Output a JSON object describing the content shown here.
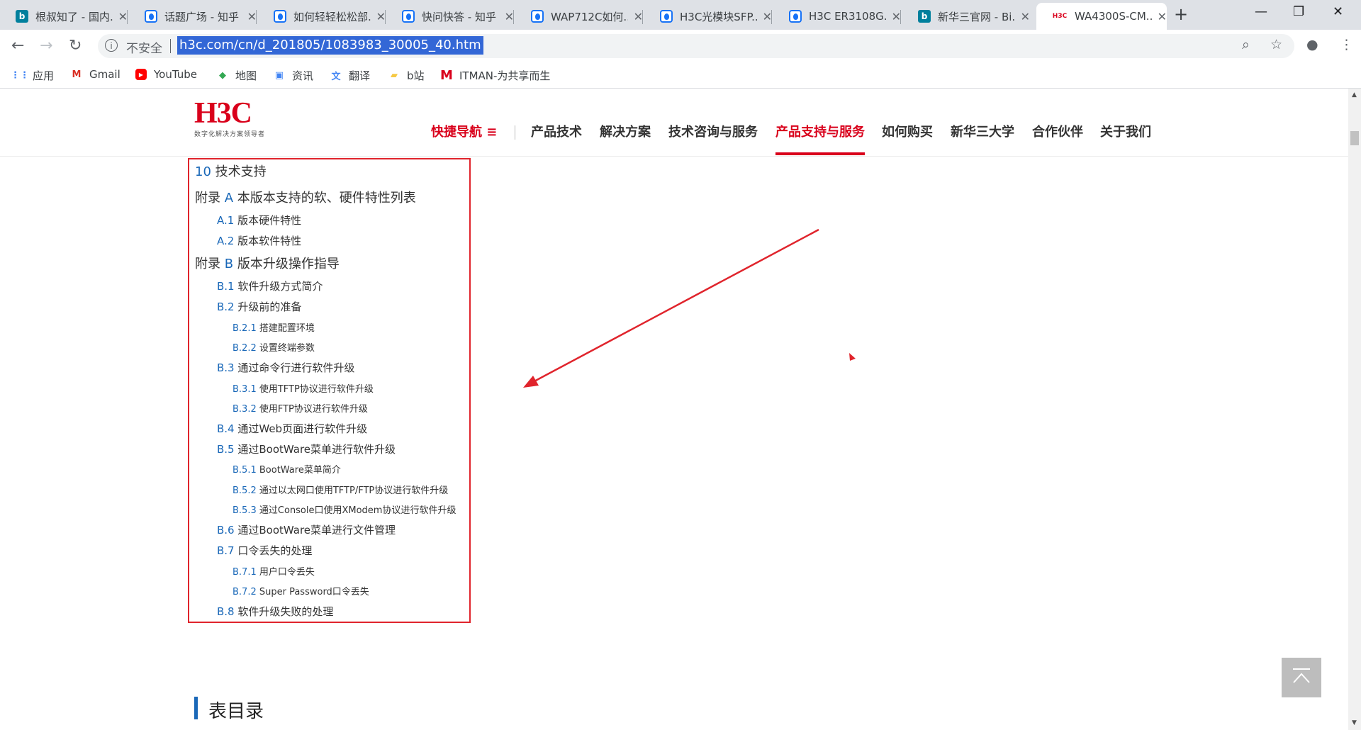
{
  "browser": {
    "tabs": [
      {
        "icon": "bing",
        "title": "根叔知了 - 国内..."
      },
      {
        "icon": "zhihu",
        "title": "话题广场 - 知乎"
      },
      {
        "icon": "zhihu",
        "title": "如何轻轻松松部..."
      },
      {
        "icon": "zhihu",
        "title": "快问快答 - 知乎"
      },
      {
        "icon": "zhihu",
        "title": "WAP712C如何..."
      },
      {
        "icon": "zhihu",
        "title": "H3C光模块SFP..."
      },
      {
        "icon": "zhihu",
        "title": "H3C ER3108G..."
      },
      {
        "icon": "bing",
        "title": "新华三官网 - Bi..."
      },
      {
        "icon": "h3c",
        "title": "WA4300S-CM..."
      }
    ],
    "active_tab_index": 8,
    "omnibox": {
      "security_label": "不安全",
      "url": "h3c.com/cn/d_201805/1083983_30005_40.htm"
    },
    "bookmarks": [
      {
        "icon": "apps",
        "label": "应用"
      },
      {
        "icon": "gmail",
        "label": "Gmail"
      },
      {
        "icon": "youtube",
        "label": "YouTube"
      },
      {
        "icon": "maps",
        "label": "地图"
      },
      {
        "icon": "news",
        "label": "资讯"
      },
      {
        "icon": "translate",
        "label": "翻译"
      },
      {
        "icon": "folder",
        "label": "b站"
      },
      {
        "icon": "itman",
        "label": "ITMAN-为共享而生"
      }
    ]
  },
  "site": {
    "logo": {
      "mark": "H3C",
      "slogan": "数字化解决方案领导者"
    },
    "nav": {
      "quick": "快捷导航 ≡",
      "items": [
        "产品技术",
        "解决方案",
        "技术咨询与服务",
        "产品支持与服务",
        "如何购买",
        "新华三大学",
        "合作伙伴",
        "关于我们"
      ],
      "active": "产品支持与服务"
    }
  },
  "toc": [
    {
      "num": "10",
      "text": " 技术支持",
      "level": 1
    },
    {
      "num": "附录 A",
      "text": " 本版本支持的软、硬件特性列表",
      "level": 1
    },
    {
      "num": "A.1",
      "text": " 版本硬件特性",
      "level": 2
    },
    {
      "num": "A.2",
      "text": " 版本软件特性",
      "level": 2
    },
    {
      "num": "附录 B",
      "text": " 版本升级操作指导",
      "level": 1
    },
    {
      "num": "B.1",
      "text": " 软件升级方式简介",
      "level": 2
    },
    {
      "num": "B.2",
      "text": " 升级前的准备",
      "level": 2
    },
    {
      "num": "B.2.1",
      "text": " 搭建配置环境",
      "level": 3
    },
    {
      "num": "B.2.2",
      "text": " 设置终端参数",
      "level": 3
    },
    {
      "num": "B.3",
      "text": " 通过命令行进行软件升级",
      "level": 2
    },
    {
      "num": "B.3.1",
      "text": " 使用TFTP协议进行软件升级",
      "level": 3
    },
    {
      "num": "B.3.2",
      "text": " 使用FTP协议进行软件升级",
      "level": 3
    },
    {
      "num": "B.4",
      "text": " 通过Web页面进行软件升级",
      "level": 2
    },
    {
      "num": "B.5",
      "text": " 通过BootWare菜单进行软件升级",
      "level": 2
    },
    {
      "num": "B.5.1",
      "text": " BootWare菜单简介",
      "level": 3
    },
    {
      "num": "B.5.2",
      "text": " 通过以太网口使用TFTP/FTP协议进行软件升级",
      "level": 3
    },
    {
      "num": "B.5.3",
      "text": " 通过Console口使用XModem协议进行软件升级",
      "level": 3
    },
    {
      "num": "B.6",
      "text": " 通过BootWare菜单进行文件管理",
      "level": 2
    },
    {
      "num": "B.7",
      "text": " 口令丢失的处理",
      "level": 2
    },
    {
      "num": "B.7.1",
      "text": " 用户口令丢失",
      "level": 3
    },
    {
      "num": "B.7.2",
      "text": " Super Password口令丢失",
      "level": 3
    },
    {
      "num": "B.8",
      "text": " 软件升级失败的处理",
      "level": 2
    }
  ],
  "section": {
    "title": "表目录"
  },
  "colors": {
    "h3c_red": "#d9001b",
    "link_blue": "#1a68b8",
    "annotation_red": "#e0242c"
  }
}
